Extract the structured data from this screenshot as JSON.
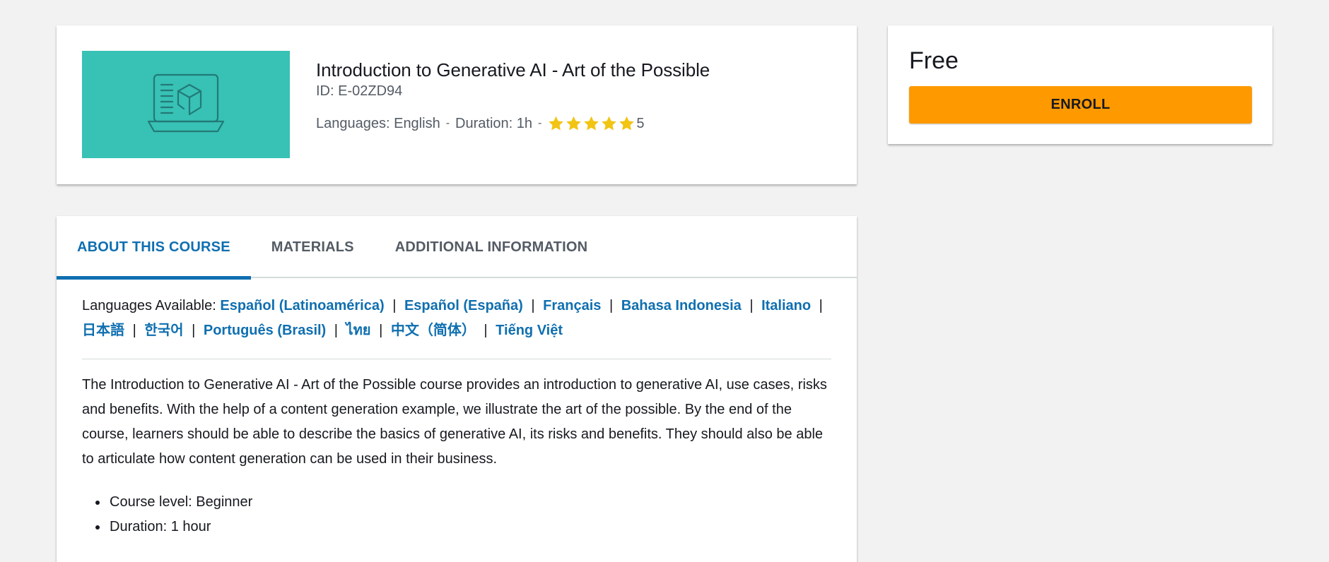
{
  "course": {
    "title": "Introduction to Generative AI - Art of the Possible",
    "id_label": "ID: E-02ZD94",
    "languages_label": "Languages: English",
    "duration_label": "Duration: 1h",
    "separator": "-",
    "rating": {
      "value": 5,
      "max": 5,
      "display": "5",
      "star_color": "#f2c413"
    },
    "thumbnail": {
      "icon": "laptop-cube-icon",
      "background": "#38c1b5",
      "line_color": "#227a77"
    }
  },
  "purchase": {
    "price": "Free",
    "enroll_label": "ENROLL",
    "button_color": "#ff9900"
  },
  "tabs": [
    {
      "label": "ABOUT THIS COURSE",
      "active": true
    },
    {
      "label": "MATERIALS",
      "active": false
    },
    {
      "label": "ADDITIONAL INFORMATION",
      "active": false
    }
  ],
  "about": {
    "languages_available_label": "Languages Available:",
    "languages": [
      "Español (Latinoamérica)",
      "Español (España)",
      "Français",
      "Bahasa Indonesia",
      "Italiano",
      "日本語",
      "한국어",
      "Português (Brasil)",
      "ไทย",
      "中文（简体）",
      "Tiếng Việt"
    ],
    "description": "The Introduction to Generative AI - Art of the Possible course provides an introduction to generative AI, use cases, risks and benefits. With the help of a content generation example, we illustrate the art of the possible. By the end of the course, learners should be able to describe the basics of generative AI, its risks and benefits. They should also be able to articulate how content generation can be used in their business.",
    "facts": [
      "Course level: Beginner",
      "Duration: 1 hour"
    ]
  },
  "colors": {
    "link": "#0f6fb0",
    "active_tab": "#0f6fb0",
    "page_background": "#f2f2f2"
  }
}
